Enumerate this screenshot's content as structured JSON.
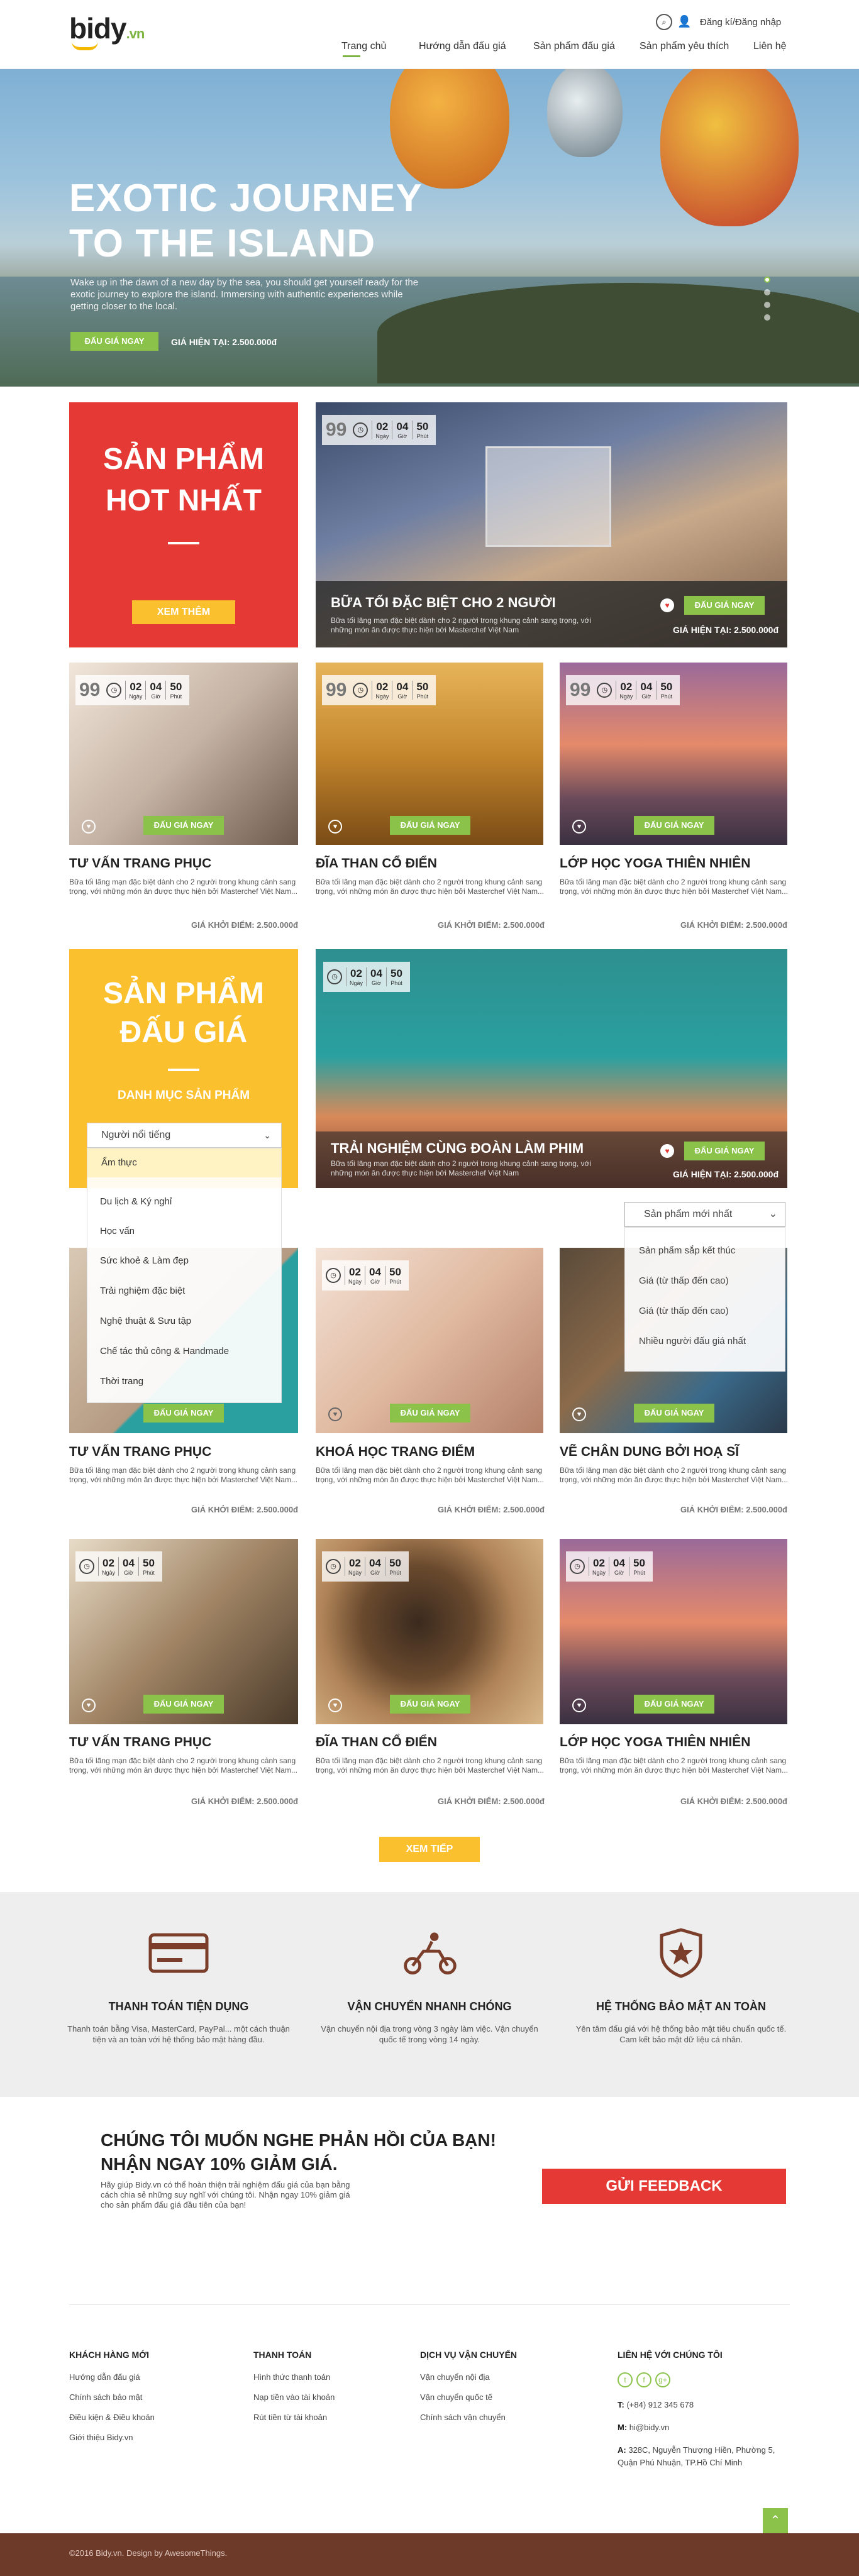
{
  "header": {
    "logo_main": "bidy",
    "logo_suffix": ".vn",
    "login": "Đăng kí/Đăng nhập",
    "nav": [
      "Trang chủ",
      "Hướng dẫn đấu giá",
      "Sản phẩm đấu giá",
      "Sản phẩm yêu thích",
      "Liên hệ"
    ]
  },
  "hero": {
    "title": "EXOTIC JOURNEY TO THE ISLAND",
    "text": "Wake up in the dawn of a new day by the sea, you should get yourself ready for the exotic journey to explore the island. Immersing with authentic experiences while getting closer to the local.",
    "button": "ĐẤU GIÁ NGAY",
    "price": "GIÁ HIỆN TẠI: 2.500.000đ",
    "slides": 4,
    "active_slide": 1
  },
  "hot": {
    "title": "SẢN PHẨM HOT NHẤT",
    "more": "XEM THÊM",
    "featured": {
      "percent": "99",
      "days": "02",
      "hours": "04",
      "minutes": "50",
      "title": "BỮA TỐI ĐẶC BIỆT CHO 2 NGƯỜI",
      "desc": "Bữa tối lãng mạn đặc biệt dành cho 2 người trong khung cảnh sang trọng, với những món ăn được thực hiện bởi Masterchef Việt Nam",
      "button": "ĐẤU GIÁ NGAY",
      "price": "GIÁ HIỆN TẠI: 2.500.000đ"
    },
    "products": [
      {
        "percent": "99",
        "title": "TƯ VẤN TRANG PHỤC",
        "desc": "Bữa tối lãng mạn đặc biệt dành cho 2 người trong khung cảnh sang trọng, với những món ăn được thực hiện bởi Masterchef Việt Nam...",
        "price": "GIÁ KHỞI ĐIỂM: 2.500.000đ"
      },
      {
        "percent": "99",
        "title": "ĐĨA THAN CỔ ĐIỂN",
        "desc": "Bữa tối lãng mạn đặc biệt dành cho 2 người trong khung cảnh sang trọng, với những món ăn được thực hiện bởi Masterchef Việt Nam...",
        "price": "GIÁ KHỞI ĐIỂM: 2.500.000đ"
      },
      {
        "percent": "99",
        "title": "LỚP HỌC YOGA THIÊN NHIÊN",
        "desc": "Bữa tối lãng mạn đặc biệt dành cho 2 người trong khung cảnh sang trọng, với những món ăn được thực hiện bởi Masterchef Việt Nam...",
        "price": "GIÁ KHỞI ĐIỂM: 2.500.000đ"
      }
    ]
  },
  "timer_labels": {
    "day": "Ngày",
    "hour": "Giờ",
    "minute": "Phút"
  },
  "auction": {
    "title": "SẢN PHẨM ĐẤU GIÁ",
    "category_heading": "DANH MỤC SẢN PHẨM",
    "category_selected": "Người nổi tiếng",
    "categories": [
      "Ẩm thực",
      "Du lịch & Ký nghỉ",
      "Học vấn",
      "Sức khoẻ & Làm đẹp",
      "Trải nghiệm đặc biệt",
      "Nghệ thuật & Sưu tập",
      "Chế tác thủ công & Handmade",
      "Thời trang"
    ],
    "featured": {
      "days": "02",
      "hours": "04",
      "minutes": "50",
      "title": "TRẢI NGHIỆM CÙNG ĐOÀN LÀM PHIM",
      "desc": "Bữa tối lãng mạn đặc biệt dành cho 2 người trong khung cảnh sang trọng, với những món ăn được thực hiện bởi Masterchef Việt Nam",
      "button": "ĐẤU GIÁ NGAY",
      "price": "GIÁ HIỆN TẠI: 2.500.000đ"
    },
    "sort_selected": "Sản phẩm mới nhất",
    "sort_options": [
      "Sản phẩm sắp kết thúc",
      "Giá (từ thấp đến cao)",
      "Giá (từ thấp đến cao)",
      "Nhiều người đấu giá nhất"
    ],
    "products": [
      {
        "title": "TƯ VẤN TRANG PHỤC",
        "desc": "Bữa tối lãng mạn đặc biệt dành cho 2 người trong khung cảnh sang trọng, với những món ăn được thực hiện bởi Masterchef Việt Nam...",
        "price": "GIÁ KHỞI ĐIỂM: 2.500.000đ"
      },
      {
        "title": "KHOÁ HỌC TRANG ĐIỂM",
        "desc": "Bữa tối lãng mạn đặc biệt dành cho 2 người trong khung cảnh sang trọng, với những món ăn được thực hiện bởi Masterchef Việt Nam...",
        "price": "GIÁ KHỞI ĐIỂM: 2.500.000đ"
      },
      {
        "title": "VẼ CHÂN DUNG BỞI HOẠ SĨ",
        "desc": "Bữa tối lãng mạn đặc biệt dành cho 2 người trong khung cảnh sang trọng, với những món ăn được thực hiện bởi Masterchef Việt Nam...",
        "price": "GIÁ KHỞI ĐIỂM: 2.500.000đ"
      },
      {
        "title": "TƯ VẤN TRANG PHỤC",
        "desc": "Bữa tối lãng mạn đặc biệt dành cho 2 người trong khung cảnh sang trọng, với những món ăn được thực hiện bởi Masterchef Việt Nam...",
        "price": "GIÁ KHỞI ĐIỂM: 2.500.000đ"
      },
      {
        "title": "ĐĨA THAN CỔ ĐIỂN",
        "desc": "Bữa tối lãng mạn đặc biệt dành cho 2 người trong khung cảnh sang trọng, với những món ăn được thực hiện bởi Masterchef Việt Nam...",
        "price": "GIÁ KHỞI ĐIỂM: 2.500.000đ"
      },
      {
        "title": "LỚP HỌC YOGA THIÊN NHIÊN",
        "desc": "Bữa tối lãng mạn đặc biệt dành cho 2 người trong khung cảnh sang trọng, với những món ăn được thực hiện bởi Masterchef Việt Nam...",
        "price": "GIÁ KHỞI ĐIỂM: 2.500.000đ"
      }
    ],
    "bid_button": "ĐẤU GIÁ NGAY",
    "more": "XEM TIẾP"
  },
  "features": [
    {
      "icon": "credit-card-icon",
      "title": "THANH TOÁN TIỆN DỤNG",
      "text": "Thanh toán bằng Visa, MasterCard, PayPal... một cách thuận tiện và an toàn với hệ thống bảo mật hàng đầu."
    },
    {
      "icon": "scooter-delivery-icon",
      "title": "VẬN CHUYỂN NHANH CHÓNG",
      "text": "Vận chuyển nội địa trong vòng 3 ngày làm việc. Vận chuyển quốc tế trong vòng 14 ngày."
    },
    {
      "icon": "shield-star-icon",
      "title": "HỆ THỐNG BẢO MẬT AN TOÀN",
      "text": "Yên tâm đấu giá với hệ thống bảo mật tiêu chuẩn quốc tế. Cam kết bảo mật dữ liệu cá nhân."
    }
  ],
  "feedback": {
    "title_line1": "CHÚNG TÔI MUỐN NGHE PHẢN HỒI CỦA BẠN!",
    "title_line2": "NHẬN NGAY 10% GIẢM GIÁ.",
    "text": "Hãy giúp Bidy.vn có thể hoàn thiện trải nghiệm đấu giá của bạn bằng cách chia sẻ những suy nghĩ với chúng tôi. Nhận ngay 10% giảm giá cho sản phẩm đấu giá đầu tiên của bạn!",
    "button": "GỬI FEEDBACK"
  },
  "footer": {
    "col1": {
      "title": "KHÁCH HÀNG MỚI",
      "links": [
        "Hướng dẫn đấu giá",
        "Chính sách bảo mật",
        "Điều kiện & Điều khoản",
        "Giới thiệu Bidy.vn"
      ]
    },
    "col2": {
      "title": "THANH TOÁN",
      "links": [
        "Hình thức thanh toán",
        "Nạp tiền vào tài khoản",
        "Rút tiền từ tài khoản"
      ]
    },
    "col3": {
      "title": "DỊCH VỤ VẬN CHUYỂN",
      "links": [
        "Vận chuyển nội địa",
        "Vận chuyển quốc tế",
        "Chính sách vận chuyển"
      ]
    },
    "col4": {
      "title": "LIÊN HỆ VỚI CHÚNG TÔI",
      "phone_label": "T:",
      "phone": "(+84) 912 345 678",
      "mail_label": "M:",
      "mail": "hi@bidy.vn",
      "addr_label": "A:",
      "address": "328C, Nguyễn Thượng Hiền, Phường 5, Quận Phú Nhuận, TP.Hồ Chí Minh"
    },
    "copyright": "©2016 Bidy.vn. Design by AwesomeThings."
  }
}
